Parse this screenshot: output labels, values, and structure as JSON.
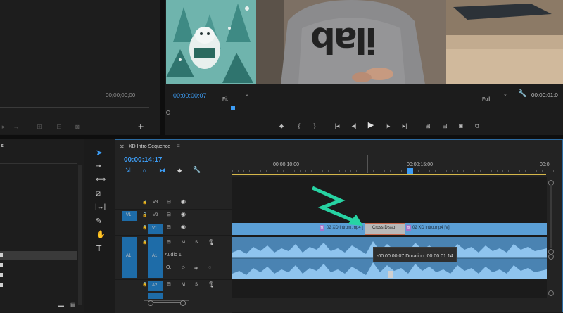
{
  "source_monitor": {
    "timecode": "00;00;00;00"
  },
  "program_monitor": {
    "timecode": "-00:00:00:07",
    "fit_label": "Fit",
    "quality_label": "Full",
    "right_timecode": "00:00:01:0",
    "shirt_logo": "ilab",
    "transport_icons": [
      "marker-icon",
      "mark-in-icon",
      "mark-out-icon",
      "go-to-in-icon",
      "step-back-icon",
      "play-icon",
      "step-forward-icon",
      "go-to-out-icon",
      "lift-icon",
      "extract-icon",
      "export-frame-icon",
      "comparison-view-icon"
    ]
  },
  "project_panel": {
    "tab_label": "s"
  },
  "timeline": {
    "title": "XD Intro Sequence",
    "menu_icon": "hamburger-icon",
    "current_timecode": "00:00:14:17",
    "ruler": {
      "labels": [
        "00:00:10:00",
        "00:00:15:00",
        "00:0"
      ]
    },
    "tracks": {
      "v3": "V3",
      "v2": "V2",
      "v1": "V1",
      "a1": "A1",
      "a2": "A2",
      "src_v1": "V1",
      "src_a1": "A1",
      "audio1_name": "Audio 1",
      "m": "M",
      "s": "S"
    },
    "clips": {
      "clip1": "02 XD Introm.mp4 [",
      "transition": "Cross Disso",
      "clip2": "02 XD Intro.mp4 [V]"
    },
    "tooltip": "-00:00:00:07 Duration: 00:00:01:14",
    "colors": {
      "clip_video": "#5b9fd6",
      "clip_audio": "#6aaee6",
      "playhead": "#3d9df5",
      "arrow": "#27d3a3",
      "transition": "#c96a50",
      "work_area": "#d5b74a",
      "accent": "#1e6ca8"
    }
  },
  "tools": [
    "selection-tool-icon",
    "track-select-icon",
    "ripple-edit-icon",
    "razor-icon",
    "slip-icon",
    "pen-icon",
    "hand-icon",
    "type-tool-icon"
  ]
}
